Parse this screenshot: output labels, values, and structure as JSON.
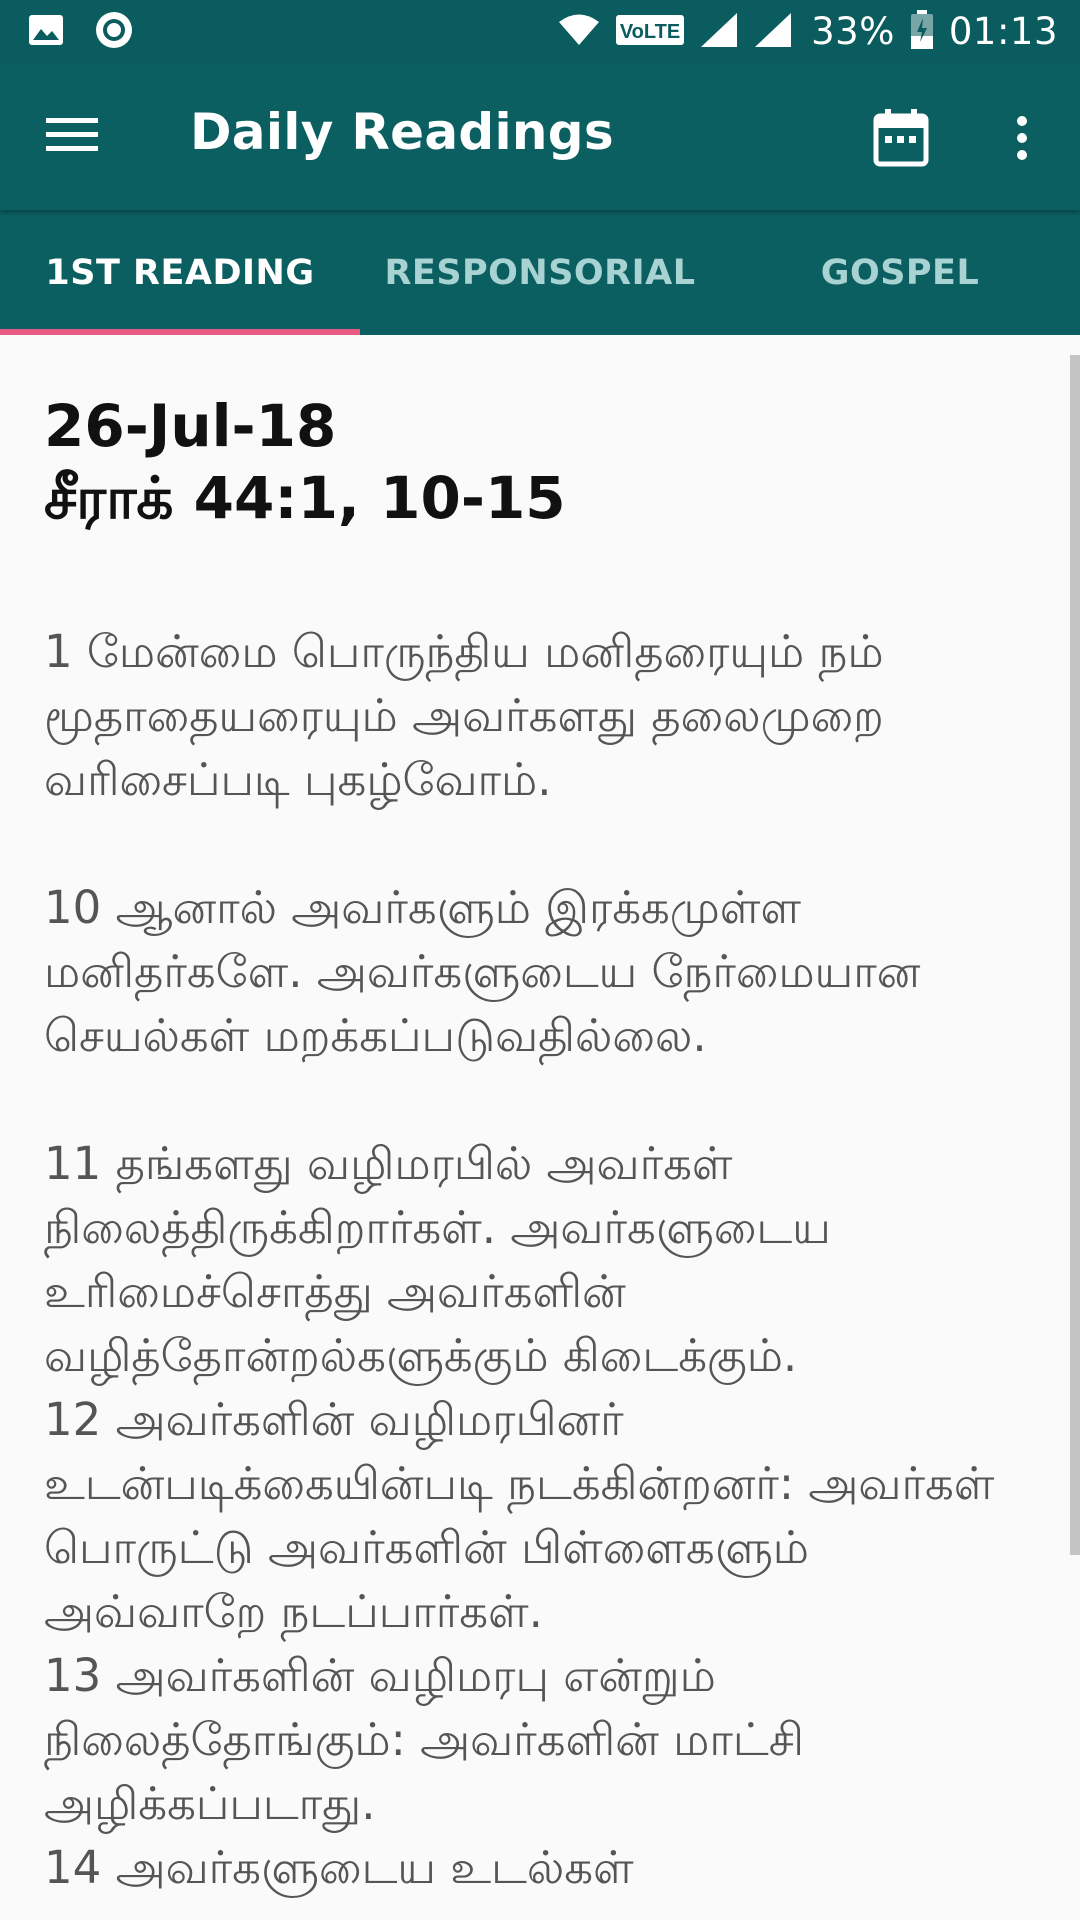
{
  "status_bar": {
    "battery": "33%",
    "time": "01:13",
    "network_badge": "VoLTE",
    "icons": [
      "image-icon",
      "circle-app-icon",
      "wifi-icon",
      "volte-icon",
      "signal-icon",
      "signal-icon",
      "battery-icon"
    ]
  },
  "app_bar": {
    "title": "Daily Readings",
    "menu_icon": "hamburger-menu-icon",
    "calendar_icon": "calendar-icon",
    "more_icon": "more-vert-icon"
  },
  "tabs": [
    {
      "label": "1ST READING",
      "active": true
    },
    {
      "label": "RESPONSORIAL",
      "active": false
    },
    {
      "label": "GOSPEL",
      "active": false
    }
  ],
  "reading": {
    "date": "26-Jul-18",
    "reference": "சீராக் 44:1, 10-15",
    "verses": [
      "1 மேன்மை பொருந்திய மனிதரையும் நம் மூதாதையரையும் அவர்களது தலைமுறை வரிசைப்படி புகழ்வோம்.",
      "10 ஆனால் அவர்களும் இரக்கமுள்ள மனிதர்களே. அவர்களுடைய நேர்மையான செயல்கள் மறக்கப்படுவதில்லை.",
      "11 தங்களது வழிமரபில் அவர்கள் நிலைத்திருக்கிறார்கள். அவர்களுடைய உரிமைச்சொத்து அவர்களின் வழித்தோன்றல்களுக்கும் கிடைக்கும்.",
      "12 அவர்களின் வழிமரபினர் உடன்படிக்கையின்படி நடக்கின்றனர்: அவர்கள் பொருட்டு அவர்களின் பிள்ளைகளும் அவ்வாறே நடப்பார்கள்.",
      "13 அவர்களின் வழிமரபு என்றும் நிலைத்தோங்கும்: அவர்களின் மாட்சி அழிக்கப்படாது.",
      "14 அவர்களுடைய உடல்கள்"
    ]
  },
  "colors": {
    "primary": "#0b5f61",
    "tab_indicator": "#e65a83",
    "tab_inactive_text": "#a9d3d2"
  }
}
